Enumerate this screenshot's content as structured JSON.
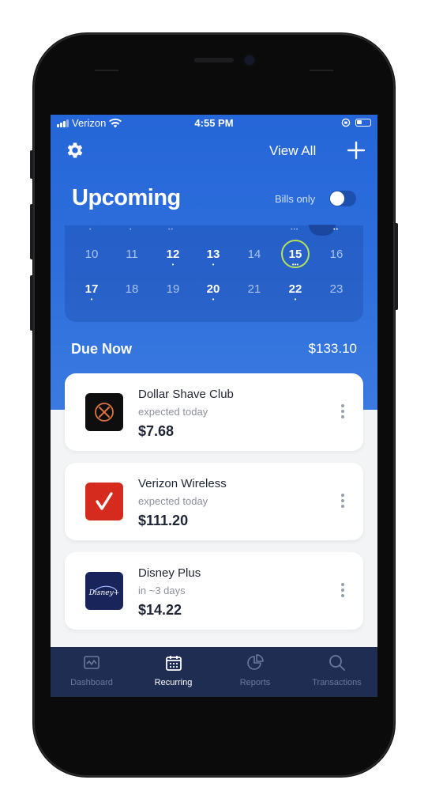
{
  "status": {
    "carrier": "Verizon",
    "time": "4:55 PM"
  },
  "header": {
    "view_all": "View All",
    "title": "Upcoming",
    "bills_only_label": "Bills only",
    "bills_only_on": false
  },
  "calendar": {
    "rows": [
      [
        {
          "d": "10",
          "bold": false,
          "dots": ""
        },
        {
          "d": "11",
          "bold": false,
          "dots": ""
        },
        {
          "d": "12",
          "bold": true,
          "dots": "•"
        },
        {
          "d": "13",
          "bold": true,
          "dots": "•"
        },
        {
          "d": "14",
          "bold": false,
          "dots": ""
        },
        {
          "d": "15",
          "bold": true,
          "dots": "•••",
          "today": true
        },
        {
          "d": "16",
          "bold": false,
          "dots": ""
        }
      ],
      [
        {
          "d": "17",
          "bold": true,
          "dots": "•"
        },
        {
          "d": "18",
          "bold": false,
          "dots": ""
        },
        {
          "d": "19",
          "bold": false,
          "dots": ""
        },
        {
          "d": "20",
          "bold": true,
          "dots": "•"
        },
        {
          "d": "21",
          "bold": false,
          "dots": ""
        },
        {
          "d": "22",
          "bold": true,
          "dots": "•"
        },
        {
          "d": "23",
          "bold": false,
          "dots": ""
        }
      ]
    ]
  },
  "due_now": {
    "label": "Due Now",
    "amount": "$133.10"
  },
  "bills": [
    {
      "name": "Dollar Shave Club",
      "sub": "expected today",
      "amount": "$7.68",
      "logo": "dollar-shave-club-logo",
      "color": "#0e0e0e"
    },
    {
      "name": "Verizon Wireless",
      "sub": "expected today",
      "amount": "$111.20",
      "logo": "verizon-logo",
      "color": "#d52b1e"
    },
    {
      "name": "Disney Plus",
      "sub": "in ~3 days",
      "amount": "$14.22",
      "logo": "disney-plus-logo",
      "color": "#18245a"
    }
  ],
  "tabs": [
    {
      "label": "Dashboard",
      "icon": "dashboard-icon",
      "active": false
    },
    {
      "label": "Recurring",
      "icon": "calendar-icon",
      "active": true
    },
    {
      "label": "Reports",
      "icon": "pie-chart-icon",
      "active": false
    },
    {
      "label": "Transactions",
      "icon": "search-icon",
      "active": false
    }
  ],
  "colors": {
    "header_blue": "#2566d8",
    "tab_bar": "#1f2d52",
    "today_ring": "#b5e35a"
  }
}
